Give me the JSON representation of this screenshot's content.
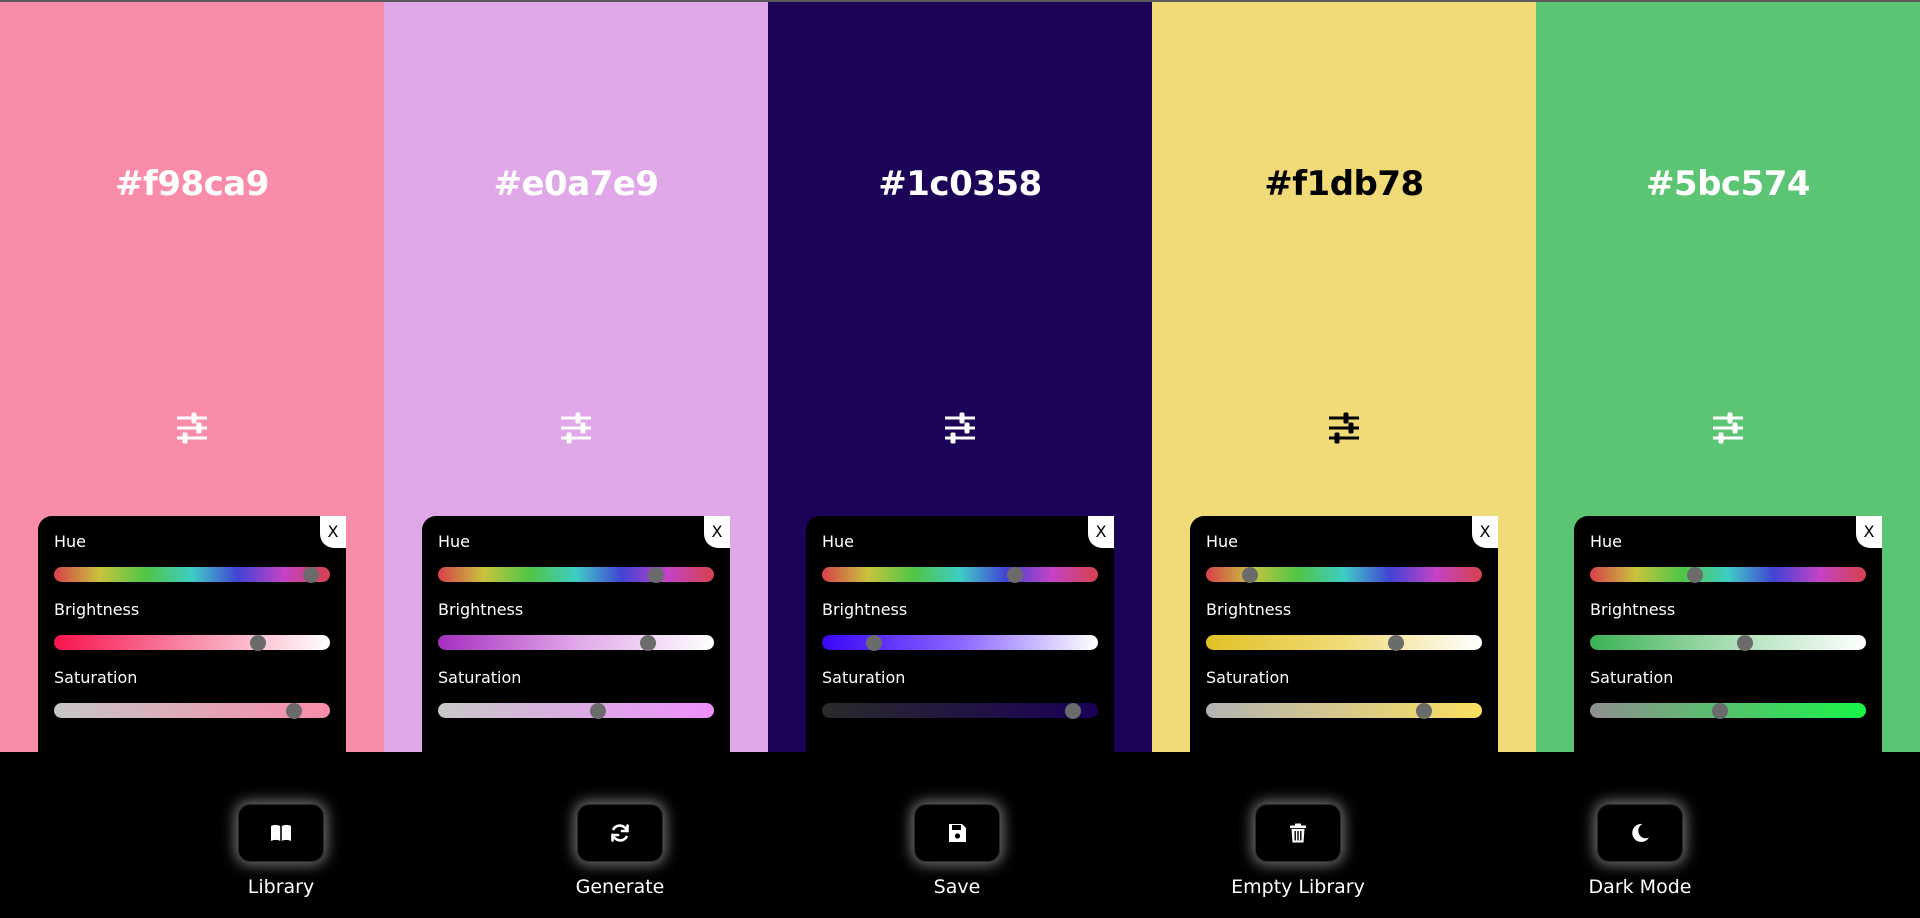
{
  "palette": {
    "columns": [
      {
        "hex": "#f98ca9",
        "bg": "#f98ca9",
        "text_color": "#ffffff",
        "adjust_icon": "sliders-icon",
        "close_label": "X",
        "hue_label": "Hue",
        "brightness_label": "Brightness",
        "saturation_label": "Saturation",
        "hue_value": 0.93,
        "brightness_value": 0.74,
        "saturation_value": 0.87,
        "brightness_gradient": [
          "#f7134d",
          "#f98ca9",
          "#ffffff"
        ],
        "saturation_gradient": [
          "#c6c6c6",
          "#f98ca9"
        ]
      },
      {
        "hex": "#e0a7e9",
        "bg": "#e0a7e9",
        "text_color": "#ffffff",
        "adjust_icon": "sliders-icon",
        "close_label": "X",
        "hue_label": "Hue",
        "brightness_label": "Brightness",
        "saturation_label": "Saturation",
        "hue_value": 0.79,
        "brightness_value": 0.76,
        "saturation_value": 0.58,
        "brightness_gradient": [
          "#a52fbf",
          "#e0a7e9",
          "#ffffff"
        ],
        "saturation_gradient": [
          "#c8c8c8",
          "#ee8ffd"
        ]
      },
      {
        "hex": "#1c0358",
        "bg": "#1c0358",
        "text_color": "#ffffff",
        "adjust_icon": "sliders-icon",
        "close_label": "X",
        "hue_label": "Hue",
        "brightness_label": "Brightness",
        "saturation_label": "Saturation",
        "hue_value": 0.7,
        "brightness_value": 0.19,
        "saturation_value": 0.91,
        "brightness_gradient": [
          "#3b06f5",
          "#8a66ff",
          "#ffffff"
        ],
        "saturation_gradient": [
          "#2a2a2a",
          "#1a0058"
        ]
      },
      {
        "hex": "#f1db78",
        "bg": "#f1db78",
        "text_color": "#000000",
        "adjust_icon": "sliders-icon",
        "close_label": "X",
        "hue_label": "Hue",
        "brightness_label": "Brightness",
        "saturation_label": "Saturation",
        "hue_value": 0.16,
        "brightness_value": 0.69,
        "saturation_value": 0.79,
        "brightness_gradient": [
          "#e2c126",
          "#f1db78",
          "#ffffff"
        ],
        "saturation_gradient": [
          "#b3b3b3",
          "#fbdf5f"
        ]
      },
      {
        "hex": "#5bc574",
        "bg": "#5bc574",
        "text_color": "#ffffff",
        "adjust_icon": "sliders-icon",
        "close_label": "X",
        "hue_label": "Hue",
        "brightness_label": "Brightness",
        "saturation_label": "Saturation",
        "hue_value": 0.38,
        "brightness_value": 0.56,
        "saturation_value": 0.47,
        "brightness_gradient": [
          "#3bb255",
          "#a8deb3",
          "#ffffff"
        ],
        "saturation_gradient": [
          "#8f8f8f",
          "#19f547"
        ]
      }
    ]
  },
  "toolbar": {
    "items": [
      {
        "label": "Library",
        "icon": "book-icon"
      },
      {
        "label": "Generate",
        "icon": "refresh-icon"
      },
      {
        "label": "Save",
        "icon": "save-icon"
      },
      {
        "label": "Empty Library",
        "icon": "trash-icon"
      },
      {
        "label": "Dark Mode",
        "icon": "moon-icon"
      }
    ]
  },
  "colors": {
    "hue_track": [
      "#d6424b",
      "#c8c43c",
      "#4fc646",
      "#3fcdc6",
      "#4242d4",
      "#c542c6",
      "#d6424b"
    ],
    "thumb": "#6b6b6b",
    "toolbar_bg": "#000000"
  }
}
